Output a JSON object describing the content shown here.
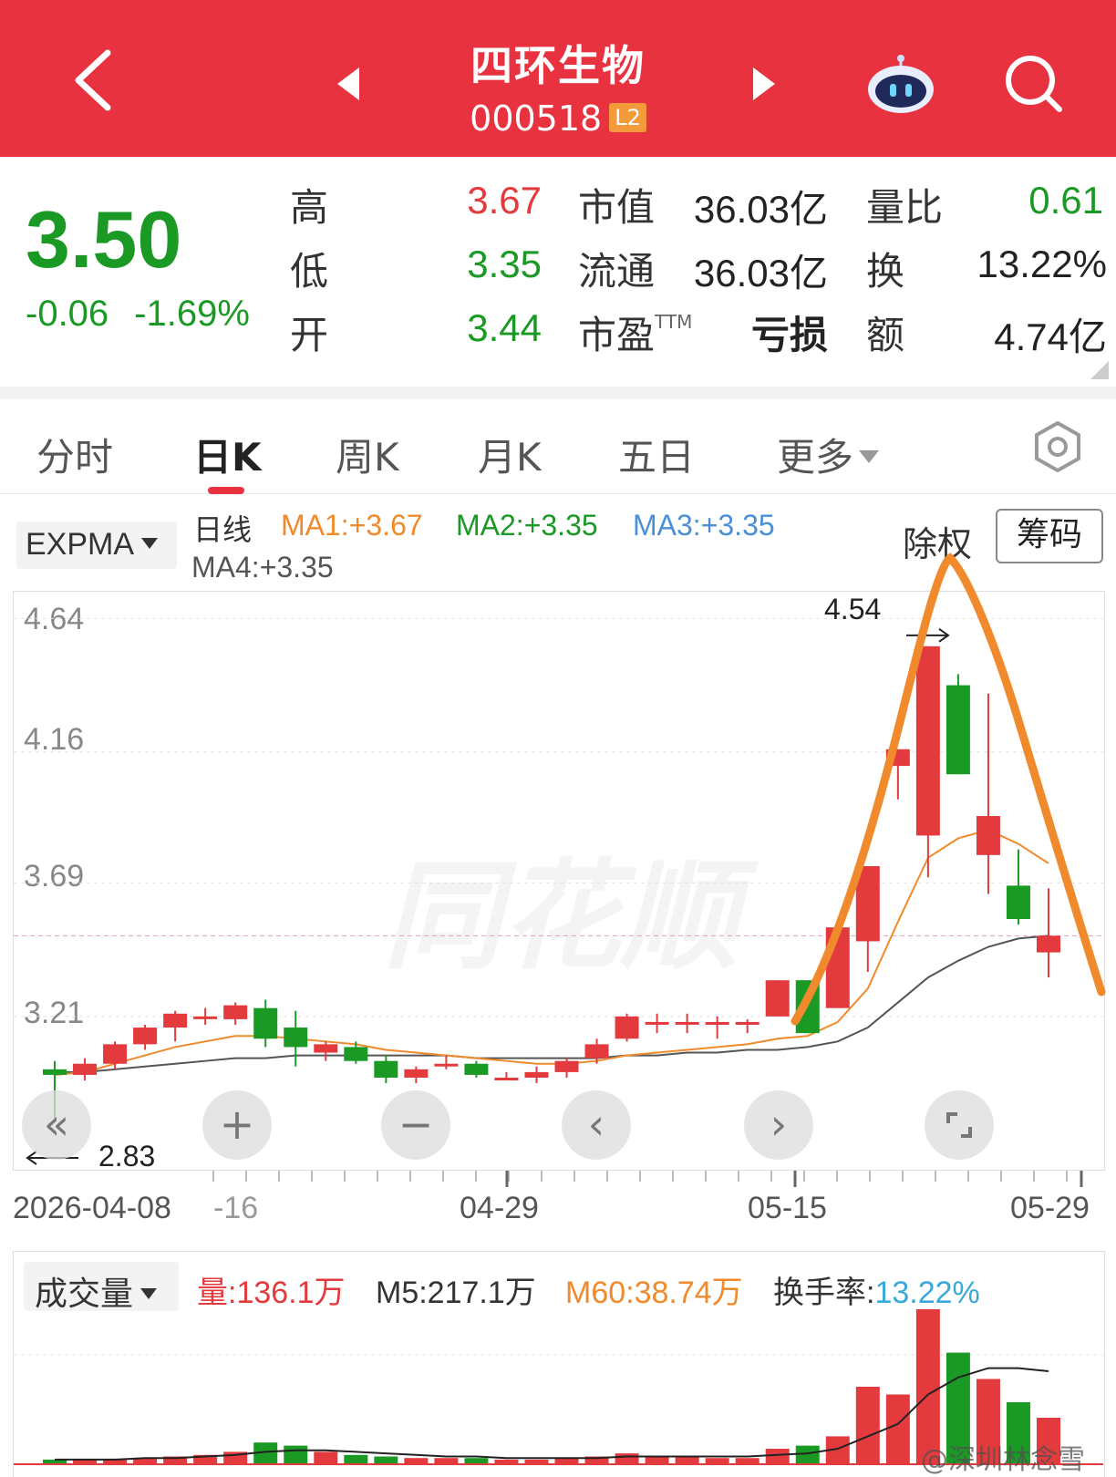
{
  "header": {
    "stock_name": "四环生物",
    "stock_code": "000518",
    "level_badge": "L2",
    "bg_color": "#e8323f"
  },
  "quote": {
    "price": "3.50",
    "change": "-0.06",
    "change_pct": "-1.69%",
    "high_label": "高",
    "high": "3.67",
    "low_label": "低",
    "low": "3.35",
    "open_label": "开",
    "open": "3.44",
    "mktcap_label": "市值",
    "mktcap": "36.03亿",
    "float_label": "流通",
    "float_cap": "36.03亿",
    "pe_label": "市盈",
    "pe_sup": "TTM",
    "pe": "亏损",
    "vol_ratio_label": "量比",
    "vol_ratio": "0.61",
    "turnover_label": "换",
    "turnover": "13.22%",
    "amount_label": "额",
    "amount": "4.74亿"
  },
  "tabs": [
    {
      "label": "分时"
    },
    {
      "label": "日K"
    },
    {
      "label": "周K"
    },
    {
      "label": "月K"
    },
    {
      "label": "五日"
    },
    {
      "label": "更多"
    }
  ],
  "indicator": {
    "selected": "EXPMA",
    "period": "日线",
    "ma1": "MA1:+3.67",
    "ma2": "MA2:+3.35",
    "ma3": "MA3:+3.35",
    "ma4": "MA4:+3.35",
    "adjust_label": "除权",
    "chips_button": "筹码"
  },
  "chart_data": {
    "type": "candlestick",
    "y_ticks": [
      "4.64",
      "4.16",
      "3.69",
      "3.21"
    ],
    "x_ticks": [
      "2026-04-08",
      "-16",
      "04-29",
      "05-15",
      "05-29"
    ],
    "annotations": {
      "high": "4.54",
      "low": "2.83"
    },
    "watermark": "同花顺",
    "current_price_line": 3.5,
    "candles": [
      {
        "o": 3.02,
        "h": 3.05,
        "l": 2.83,
        "c": 3.0
      },
      {
        "o": 3.0,
        "h": 3.06,
        "l": 2.98,
        "c": 3.04
      },
      {
        "o": 3.04,
        "h": 3.12,
        "l": 3.02,
        "c": 3.11
      },
      {
        "o": 3.11,
        "h": 3.18,
        "l": 3.09,
        "c": 3.17
      },
      {
        "o": 3.17,
        "h": 3.23,
        "l": 3.12,
        "c": 3.22
      },
      {
        "o": 3.21,
        "h": 3.24,
        "l": 3.18,
        "c": 3.21
      },
      {
        "o": 3.2,
        "h": 3.26,
        "l": 3.18,
        "c": 3.25
      },
      {
        "o": 3.24,
        "h": 3.27,
        "l": 3.1,
        "c": 3.13
      },
      {
        "o": 3.17,
        "h": 3.23,
        "l": 3.03,
        "c": 3.1
      },
      {
        "o": 3.08,
        "h": 3.12,
        "l": 3.05,
        "c": 3.11
      },
      {
        "o": 3.1,
        "h": 3.12,
        "l": 3.04,
        "c": 3.05
      },
      {
        "o": 3.05,
        "h": 3.07,
        "l": 2.97,
        "c": 2.99
      },
      {
        "o": 2.99,
        "h": 3.03,
        "l": 2.97,
        "c": 3.02
      },
      {
        "o": 3.04,
        "h": 3.07,
        "l": 3.02,
        "c": 3.04
      },
      {
        "o": 3.04,
        "h": 3.05,
        "l": 2.99,
        "c": 3.0
      },
      {
        "o": 2.99,
        "h": 3.01,
        "l": 2.98,
        "c": 2.99
      },
      {
        "o": 2.99,
        "h": 3.03,
        "l": 2.97,
        "c": 3.01
      },
      {
        "o": 3.01,
        "h": 3.06,
        "l": 2.99,
        "c": 3.05
      },
      {
        "o": 3.06,
        "h": 3.13,
        "l": 3.04,
        "c": 3.11
      },
      {
        "o": 3.13,
        "h": 3.22,
        "l": 3.12,
        "c": 3.21
      },
      {
        "o": 3.19,
        "h": 3.22,
        "l": 3.15,
        "c": 3.19
      },
      {
        "o": 3.19,
        "h": 3.22,
        "l": 3.15,
        "c": 3.19
      },
      {
        "o": 3.18,
        "h": 3.21,
        "l": 3.13,
        "c": 3.19
      },
      {
        "o": 3.18,
        "h": 3.2,
        "l": 3.15,
        "c": 3.19
      },
      {
        "o": 3.21,
        "h": 3.34,
        "l": 3.21,
        "c": 3.34
      },
      {
        "o": 3.34,
        "h": 3.34,
        "l": 3.15,
        "c": 3.15
      },
      {
        "o": 3.24,
        "h": 3.53,
        "l": 3.24,
        "c": 3.53
      },
      {
        "o": 3.48,
        "h": 3.75,
        "l": 3.37,
        "c": 3.75
      },
      {
        "o": 4.11,
        "h": 4.17,
        "l": 3.99,
        "c": 4.17
      },
      {
        "o": 3.86,
        "h": 4.54,
        "l": 3.71,
        "c": 4.54
      },
      {
        "o": 4.4,
        "h": 4.44,
        "l": 4.08,
        "c": 4.08
      },
      {
        "o": 3.79,
        "h": 4.37,
        "l": 3.65,
        "c": 3.93
      },
      {
        "o": 3.68,
        "h": 3.81,
        "l": 3.54,
        "c": 3.56
      },
      {
        "o": 3.44,
        "h": 3.67,
        "l": 3.35,
        "c": 3.5
      }
    ],
    "ema_short": [
      3.0,
      3.01,
      3.04,
      3.07,
      3.1,
      3.12,
      3.14,
      3.14,
      3.13,
      3.12,
      3.11,
      3.09,
      3.08,
      3.07,
      3.06,
      3.05,
      3.04,
      3.04,
      3.05,
      3.07,
      3.08,
      3.09,
      3.1,
      3.11,
      3.13,
      3.14,
      3.19,
      3.31,
      3.55,
      3.78,
      3.85,
      3.88,
      3.83,
      3.76
    ],
    "ema_long": [
      3.01,
      3.01,
      3.02,
      3.03,
      3.04,
      3.05,
      3.06,
      3.06,
      3.07,
      3.07,
      3.07,
      3.07,
      3.07,
      3.07,
      3.06,
      3.06,
      3.06,
      3.06,
      3.06,
      3.07,
      3.07,
      3.08,
      3.08,
      3.09,
      3.09,
      3.1,
      3.12,
      3.17,
      3.26,
      3.35,
      3.41,
      3.46,
      3.49,
      3.5
    ],
    "freehand_overlay_color": "#f08a2c"
  },
  "controls": {
    "rewind_icon": "double-chevron-left-icon",
    "zoom_in_icon": "plus-icon",
    "zoom_out_icon": "minus-icon",
    "prev_icon": "chevron-left-icon",
    "next_icon": "chevron-right-icon",
    "fullscreen_icon": "fullscreen-icon"
  },
  "volume": {
    "selected": "成交量",
    "vol_label": "量:",
    "vol": "136.1万",
    "m5": "M5:217.1万",
    "m60": "M60:38.74万",
    "turnover_label": "换手率:",
    "turnover": "13.22%",
    "bars_relative": [
      0.03,
      0.03,
      0.03,
      0.04,
      0.05,
      0.06,
      0.08,
      0.14,
      0.12,
      0.08,
      0.06,
      0.05,
      0.04,
      0.04,
      0.04,
      0.03,
      0.03,
      0.04,
      0.05,
      0.07,
      0.05,
      0.05,
      0.04,
      0.04,
      0.1,
      0.12,
      0.18,
      0.5,
      0.45,
      1.0,
      0.72,
      0.55,
      0.4,
      0.3
    ],
    "ma_relative": [
      0.03,
      0.03,
      0.03,
      0.04,
      0.04,
      0.05,
      0.06,
      0.08,
      0.09,
      0.09,
      0.08,
      0.07,
      0.06,
      0.05,
      0.05,
      0.04,
      0.04,
      0.04,
      0.04,
      0.05,
      0.05,
      0.05,
      0.05,
      0.05,
      0.06,
      0.07,
      0.1,
      0.18,
      0.26,
      0.45,
      0.56,
      0.62,
      0.62,
      0.6
    ]
  },
  "watermark_credit": "@深圳林念雪",
  "colors": {
    "up": "#e33a3e",
    "down": "#1a9a24",
    "ma_orange": "#f08a2c",
    "ma_dark": "#555555"
  }
}
